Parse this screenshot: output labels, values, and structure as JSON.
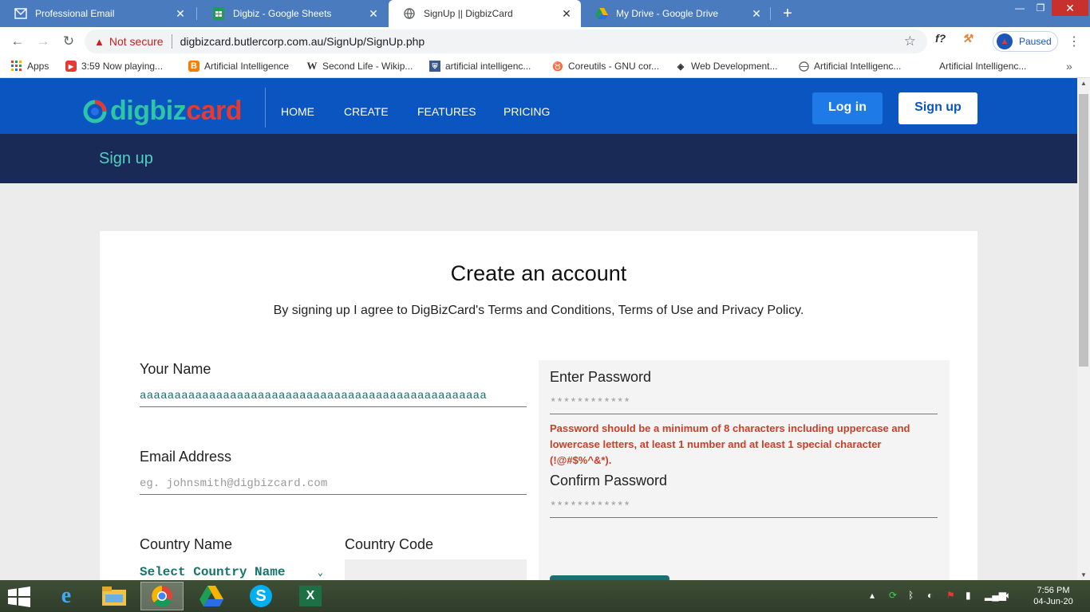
{
  "browser": {
    "tabs": [
      {
        "title": "Professional Email",
        "icon": "mail-icon"
      },
      {
        "title": "Digbiz - Google Sheets",
        "icon": "sheets-icon"
      },
      {
        "title": "SignUp || DigbizCard",
        "icon": "globe-icon"
      },
      {
        "title": "My Drive - Google Drive",
        "icon": "drive-icon"
      }
    ],
    "security_label": "Not secure",
    "url": "digbizcard.butlercorp.com.au/SignUp/SignUp.php",
    "profile_status": "Paused",
    "bookmarks": [
      {
        "label": "Apps",
        "icon": "apps-grid-icon"
      },
      {
        "label": "3:59 Now playing...",
        "icon": "youtube-icon"
      },
      {
        "label": "Artificial Intelligence",
        "icon": "blogger-icon"
      },
      {
        "label": "Second Life - Wikip...",
        "icon": "wikipedia-icon"
      },
      {
        "label": "artificial intelligenc...",
        "icon": "shield-crest-icon"
      },
      {
        "label": "Coreutils - GNU cor...",
        "icon": "gnu-icon"
      },
      {
        "label": "Web Development...",
        "icon": "diamond-icon"
      },
      {
        "label": "Artificial Intelligenc...",
        "icon": "globe-icon"
      },
      {
        "label": "Artificial Intelligenc...",
        "icon": ""
      }
    ]
  },
  "site": {
    "logo": {
      "part1": "dig",
      "part2": "biz",
      "part3": "card"
    },
    "nav": [
      "HOME",
      "CREATE",
      "FEATURES",
      "PRICING"
    ],
    "login_label": "Log in",
    "signup_label": "Sign up",
    "subheader_title": "Sign up"
  },
  "form": {
    "heading": "Create an account",
    "terms": "By signing up I agree to DigBizCard's Terms and Conditions, Terms of Use and Privacy Policy.",
    "name_label": "Your Name",
    "name_value": "aaaaaaaaaaaaaaaaaaaaaaaaaaaaaaaaaaaaaaaaaaaaaaaaaa",
    "email_label": "Email Address",
    "email_placeholder": "eg. johnsmith@digbizcard.com",
    "country_label": "Country Name",
    "country_select": "Select Country Name",
    "country_code_label": "Country Code",
    "password_label": "Enter Password",
    "password_placeholder": "************",
    "password_hint": "Password should be a minimum of 8 characters including uppercase and lowercase letters, at least 1 number and at least 1 special character (!@#$%^&*).",
    "confirm_label": "Confirm Password",
    "confirm_placeholder": "************"
  },
  "taskbar": {
    "time": "7:56 PM",
    "date": "04-Jun-20"
  }
}
